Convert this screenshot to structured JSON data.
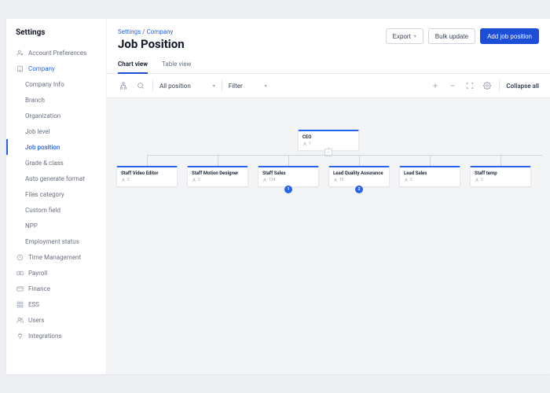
{
  "sidebar": {
    "title": "Settings",
    "items": [
      {
        "label": "Account Preferences",
        "icon": "user-gear",
        "type": "section"
      },
      {
        "label": "Company",
        "icon": "building",
        "type": "section",
        "activeParent": true
      },
      {
        "label": "Company Info",
        "type": "child"
      },
      {
        "label": "Branch",
        "type": "child"
      },
      {
        "label": "Organization",
        "type": "child"
      },
      {
        "label": "Job level",
        "type": "child"
      },
      {
        "label": "Job position",
        "type": "child",
        "activeChild": true
      },
      {
        "label": "Grade & class",
        "type": "child"
      },
      {
        "label": "Auto generate format",
        "type": "child"
      },
      {
        "label": "Files category",
        "type": "child"
      },
      {
        "label": "Custom field",
        "type": "child"
      },
      {
        "label": "NPP",
        "type": "child"
      },
      {
        "label": "Employment status",
        "type": "child"
      },
      {
        "label": "Time Management",
        "icon": "clock",
        "type": "section"
      },
      {
        "label": "Payroll",
        "icon": "cash",
        "type": "section"
      },
      {
        "label": "Finance",
        "icon": "card",
        "type": "section"
      },
      {
        "label": "ESS",
        "icon": "grid",
        "type": "section"
      },
      {
        "label": "Users",
        "icon": "users",
        "type": "section"
      },
      {
        "label": "Integrations",
        "icon": "plug",
        "type": "section"
      }
    ]
  },
  "header": {
    "breadcrumb": "Settings / Company",
    "title": "Job Position",
    "export_label": "Export",
    "bulk_label": "Bulk update",
    "add_label": "Add job position"
  },
  "tabs": {
    "chart": "Chart view",
    "table": "Table view"
  },
  "toolbar": {
    "position_filter": "All position",
    "filter_label": "Filter",
    "collapse_label": "Collapse all"
  },
  "chart_data": {
    "type": "tree",
    "root": {
      "title": "CEO",
      "count": 1
    },
    "children": [
      {
        "title": "Staff Video Editor",
        "count": 2
      },
      {
        "title": "Staff Motion Designer",
        "count": 2
      },
      {
        "title": "Staff Sales",
        "count": 134,
        "expand": 1
      },
      {
        "title": "Lead Quality Assurance",
        "count": 10,
        "expand": 2
      },
      {
        "title": "Lead Sales",
        "count": 2
      },
      {
        "title": "Staff temp",
        "count": 2
      }
    ]
  }
}
